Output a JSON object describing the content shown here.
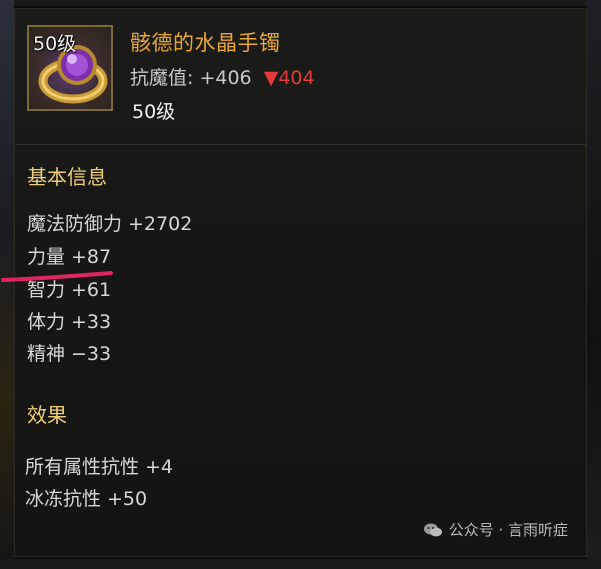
{
  "item": {
    "level_badge": "50级",
    "name": "骸德的水晶手镯",
    "resist_label": "抗魔值:",
    "resist_value": "+406",
    "resist_change": "404",
    "resist_change_arrow": "▼",
    "level": "50级",
    "icon": "crystal-bracelet-icon",
    "colors": {
      "name": "#e9a632",
      "section_title": "#eecf7a",
      "decrease": "#e23a3a"
    }
  },
  "basic_info": {
    "title": "基本信息",
    "stats": [
      {
        "label": "魔法防御力",
        "value": "+2702"
      },
      {
        "label": "力量",
        "value": "+87"
      },
      {
        "label": "智力",
        "value": "+61"
      },
      {
        "label": "体力",
        "value": "+33"
      },
      {
        "label": "精神",
        "value": "−33"
      }
    ]
  },
  "effects": {
    "title": "效果",
    "stats": [
      {
        "label": "所有属性抗性",
        "value": "+4"
      },
      {
        "label": "冰冻抗性",
        "value": "+50"
      }
    ]
  },
  "watermark": {
    "icon": "wechat-icon",
    "text": "公众号 · 言雨听症"
  }
}
